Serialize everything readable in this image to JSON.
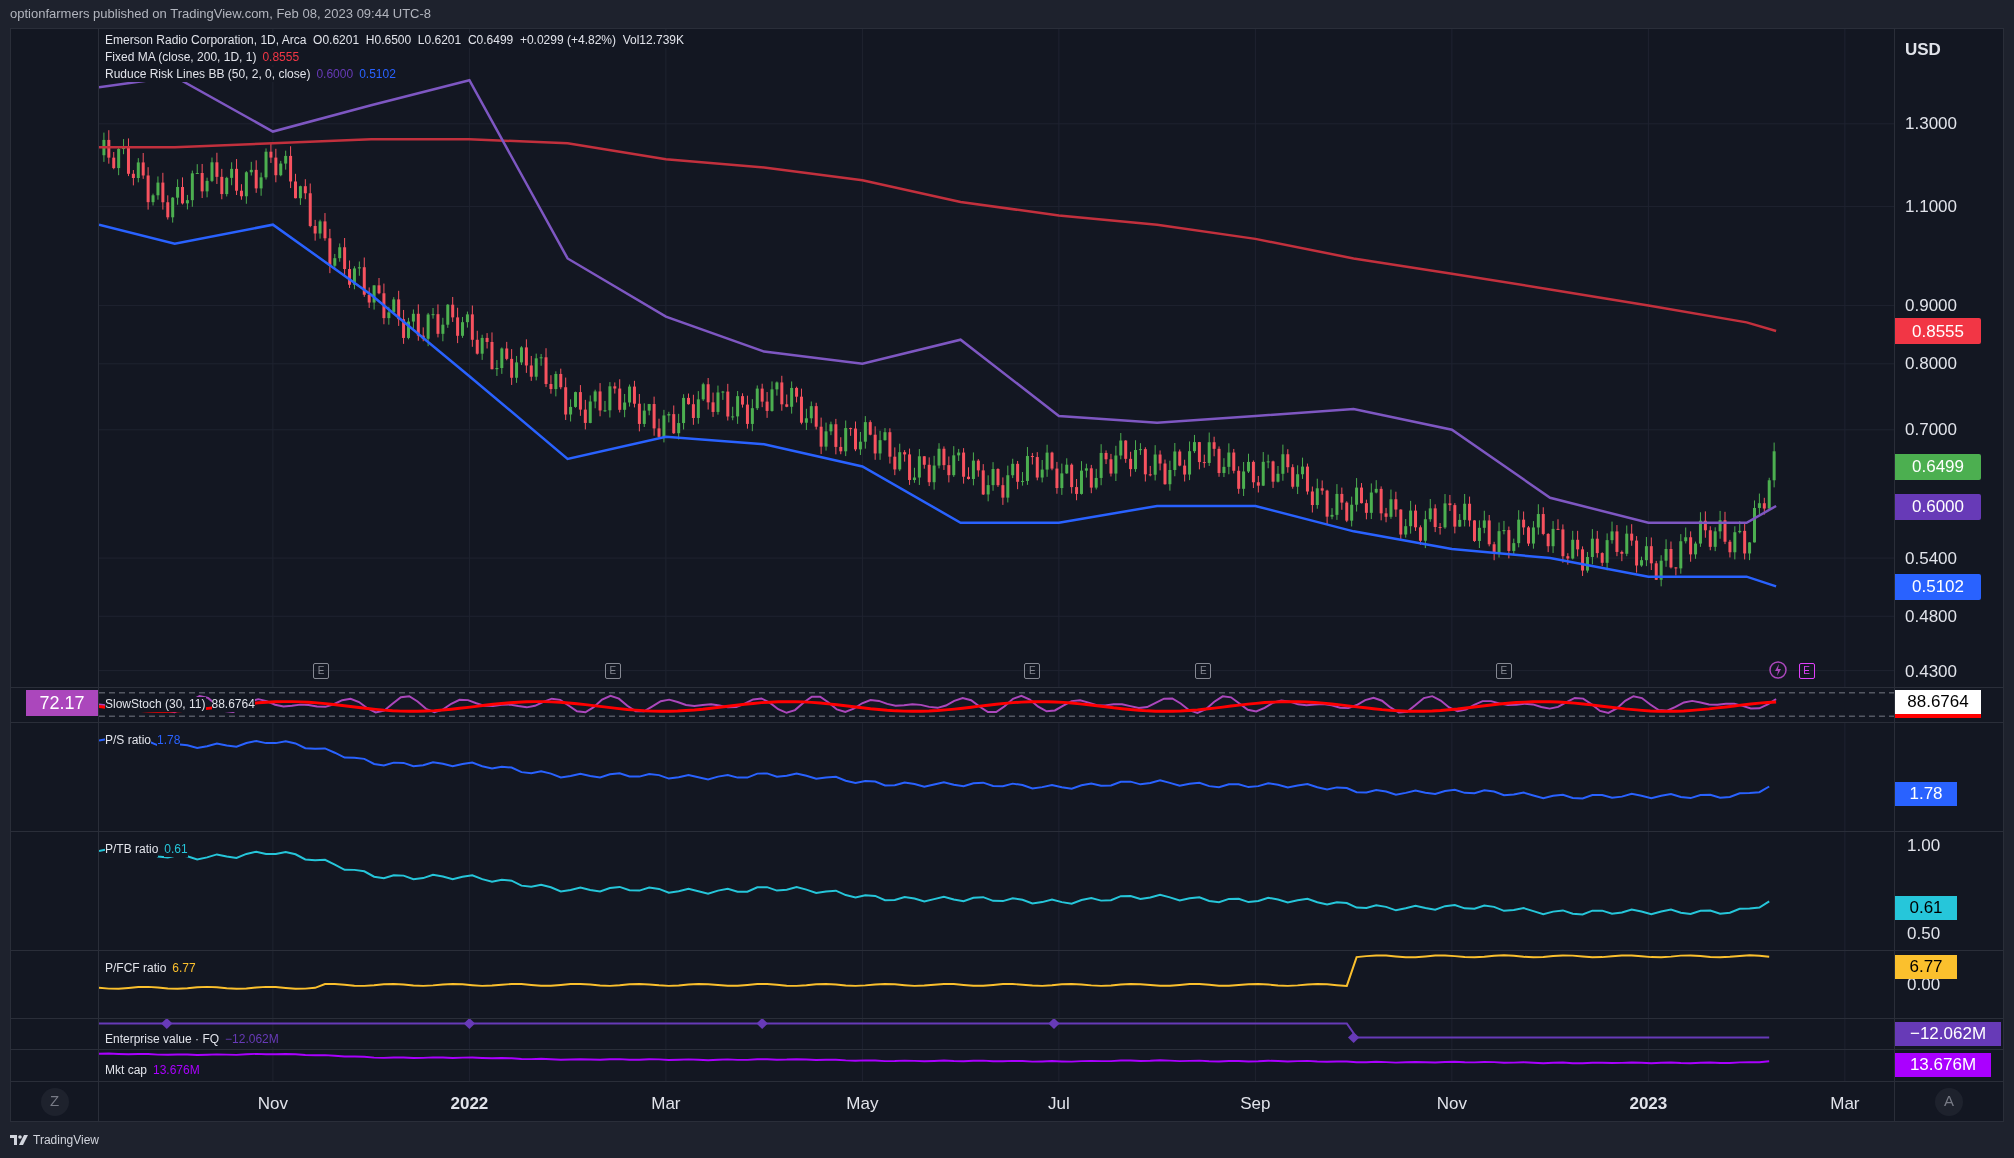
{
  "header": {
    "text": "optionfarmers published on TradingView.com, Feb 08, 2023 09:44 UTC-8"
  },
  "main_pane": {
    "legend": {
      "title": "Emerson Radio Corporation, 1D, Arca  O0.6201  H0.6500  L0.6201  C0.6499  +0.0299 (+4.82%)  Vol12.739K",
      "indicators": [
        {
          "name": "Fixed MA (close, 200, 1D, 1)",
          "values": [
            {
              "text": "0.8555",
              "color": "#f23645"
            }
          ]
        },
        {
          "name": "Ruduce Risk Lines BB (50, 2, 0, close)",
          "values": [
            {
              "text": "0.6000",
              "color": "#673ab7"
            },
            {
              "text": "0.5102",
              "color": "#2962ff"
            }
          ]
        }
      ]
    },
    "axis_unit": "USD",
    "axis_labels": [
      "1.3000",
      "1.1000",
      "0.9000",
      "0.8000",
      "0.7000",
      "0.5400",
      "0.4800",
      "0.4300"
    ],
    "badges": [
      {
        "text": "0.8555",
        "color": "#f23645"
      },
      {
        "text": "0.6499",
        "color": "#4caf50"
      },
      {
        "text": "0.6000",
        "color": "#673ab7"
      },
      {
        "text": "0.5102",
        "color": "#2962ff"
      }
    ],
    "markers": [
      {
        "kind": "earnings",
        "label": "E",
        "color": "#868993"
      },
      {
        "kind": "earnings",
        "label": "E",
        "color": "#868993"
      },
      {
        "kind": "earnings",
        "label": "E",
        "color": "#868993"
      },
      {
        "kind": "earnings",
        "label": "E",
        "color": "#868993"
      },
      {
        "kind": "earnings",
        "label": "E",
        "color": "#868993"
      },
      {
        "kind": "event",
        "color": "#ab47bc"
      },
      {
        "kind": "earnings",
        "label": "E",
        "color": "#e040fb"
      }
    ]
  },
  "stoch_pane": {
    "left_badge": "72.17",
    "name": "SlowStoch (30, 11)",
    "value": "88.6764",
    "badge": "88.6764"
  },
  "panes": [
    {
      "kind": "ratio_line",
      "name": "P/S ratio",
      "value": "1.78",
      "badge": "1.78",
      "color": "#2962ff",
      "dark_text": false
    },
    {
      "kind": "ratio_line",
      "name": "P/TB ratio",
      "value": "0.61",
      "badge": "0.61",
      "color": "#26c6da",
      "dark_text": true,
      "ticks": [
        "1.00",
        "0.50"
      ]
    },
    {
      "kind": "jump_line",
      "name": "P/FCF ratio",
      "value": "6.77",
      "badge": "6.77",
      "color": "#fbc02d",
      "dark_text": true,
      "ticks": [
        "0.00"
      ]
    },
    {
      "kind": "step_line",
      "name": "Enterprise value · FQ",
      "value": "−12.062M",
      "badge": "−12.062M",
      "color": "#673ab7",
      "dark_text": false
    },
    {
      "kind": "flat_line",
      "name": "Mkt cap",
      "value": "13.676M",
      "badge": "13.676M",
      "color": "#aa00ff",
      "dark_text": false
    }
  ],
  "time_axis": {
    "labels": [
      {
        "text": "Nov",
        "year": false
      },
      {
        "text": "2022",
        "year": true
      },
      {
        "text": "Mar",
        "year": false
      },
      {
        "text": "May",
        "year": false
      },
      {
        "text": "Jul",
        "year": false
      },
      {
        "text": "Sep",
        "year": false
      },
      {
        "text": "Nov",
        "year": false
      },
      {
        "text": "2023",
        "year": true
      },
      {
        "text": "Mar",
        "year": false
      }
    ],
    "left_button": "Z",
    "right_button": "A"
  },
  "footer": {
    "brand": "TradingView"
  }
}
